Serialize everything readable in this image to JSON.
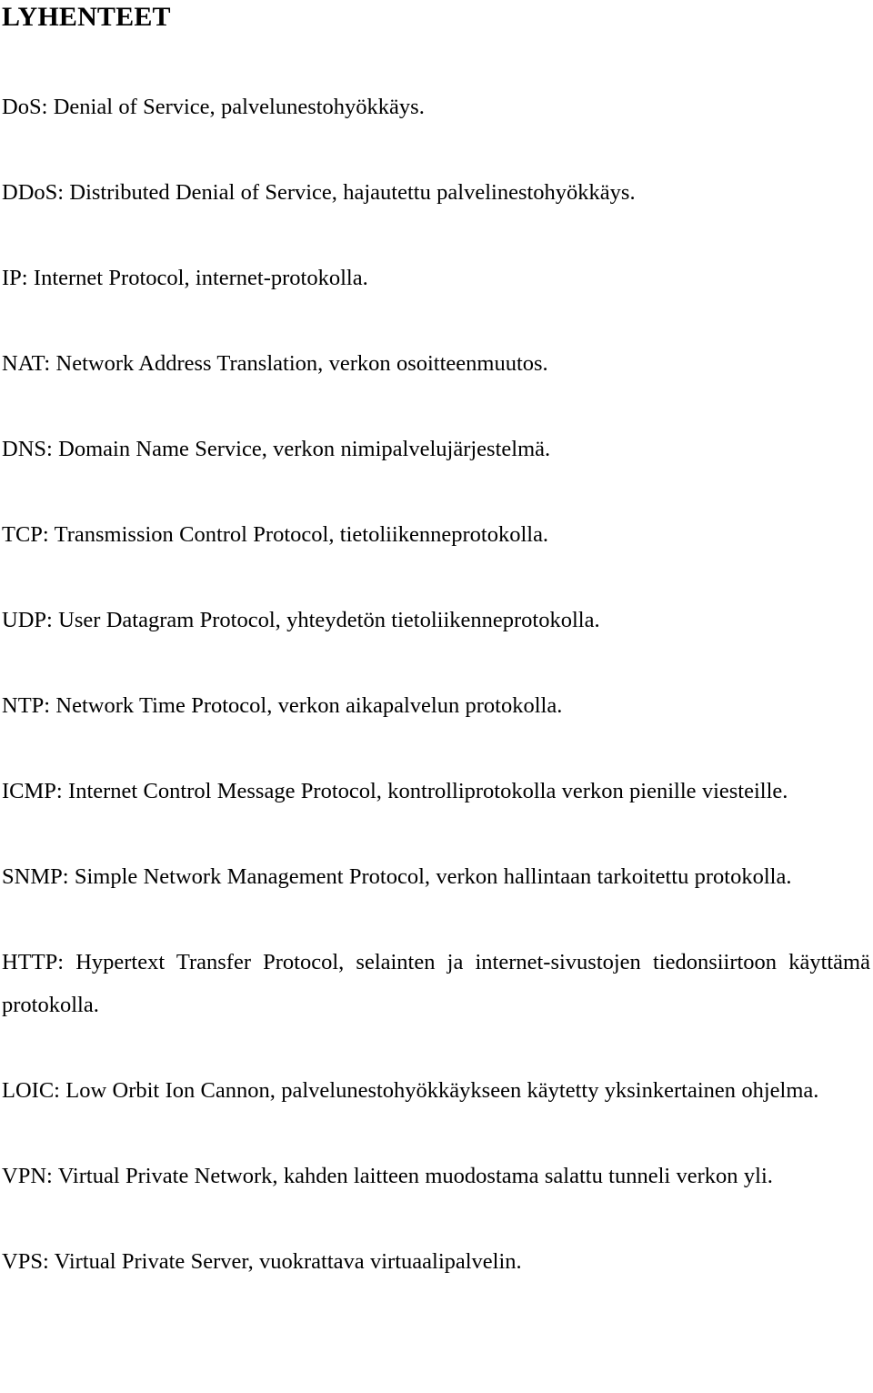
{
  "document": {
    "title": "LYHENTEET",
    "language": "fi",
    "entries": [
      "DoS: Denial of Service, palvelunestohyökkäys.",
      "DDoS: Distributed Denial of Service, hajautettu palvelinestohyökkäys.",
      "IP: Internet Protocol, internet-protokolla.",
      "NAT: Network Address Translation, verkon osoitteenmuutos.",
      "DNS: Domain Name Service, verkon nimipalvelujärjestelmä.",
      "TCP: Transmission Control Protocol, tietoliikenneprotokolla.",
      "UDP: User Datagram Protocol, yhteydetön tietoliikenneprotokolla.",
      "NTP: Network Time Protocol, verkon aikapalvelun protokolla.",
      "ICMP: Internet Control Message Protocol, kontrolliprotokolla verkon pienille viesteille.",
      "SNMP: Simple Network Management Protocol, verkon hallintaan tarkoitettu protokolla.",
      "HTTP: Hypertext Transfer Protocol, selainten ja internet-sivustojen tiedonsiirtoon käyttämä protokolla.",
      "LOIC: Low Orbit Ion Cannon, palvelunestohyökkäykseen käytetty yksinkertainen ohjelma.",
      "VPN: Virtual Private Network, kahden laitteen muodostama salattu tunneli verkon yli.",
      "VPS: Virtual Private Server, vuokrattava virtuaalipalvelin."
    ]
  }
}
